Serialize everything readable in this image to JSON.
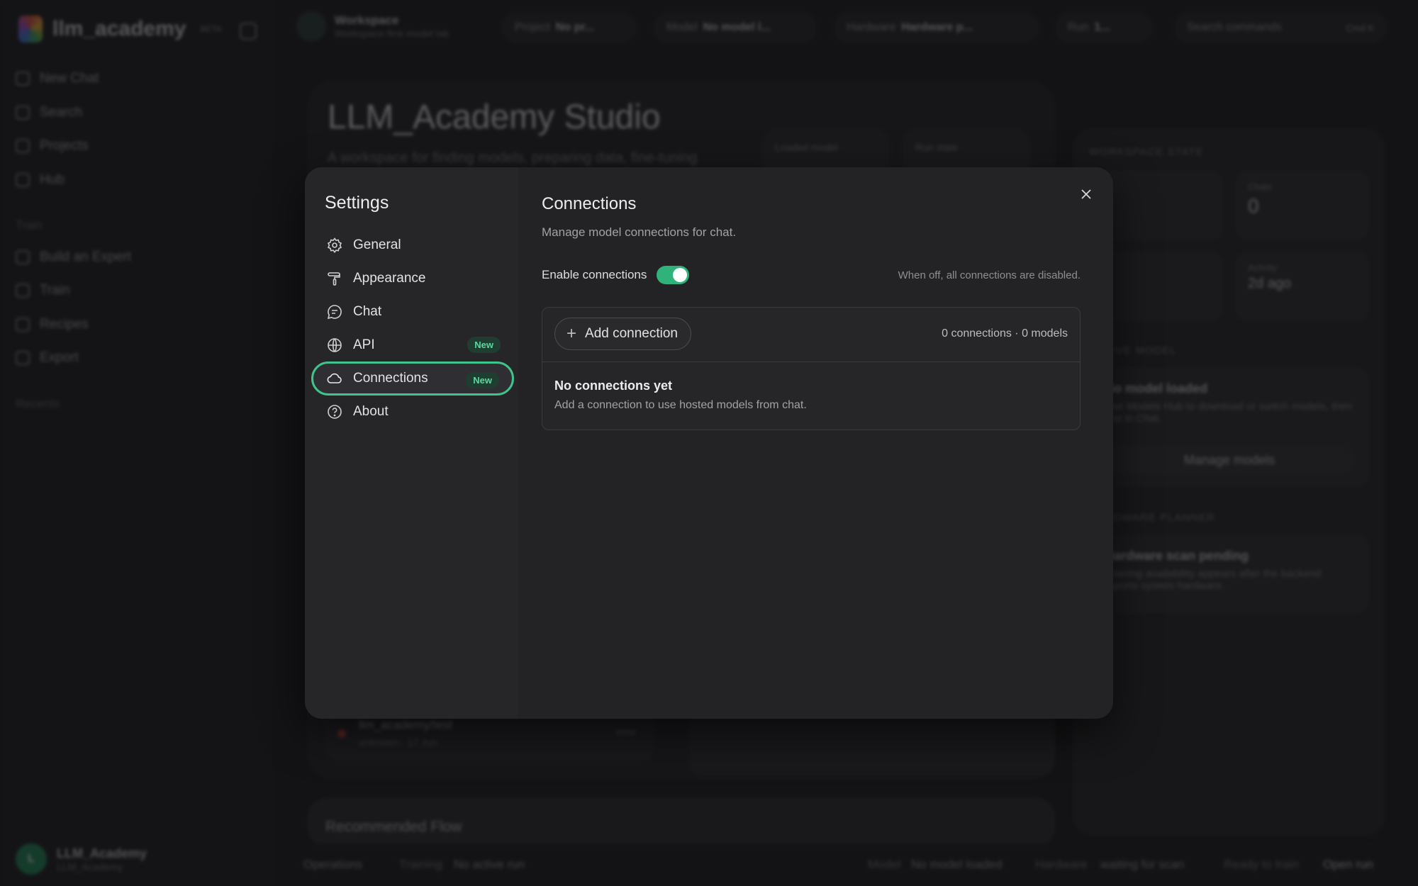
{
  "app": {
    "name": "llm_academy",
    "beta_label": "BETA",
    "sidebar": {
      "items": [
        {
          "label": "New Chat"
        },
        {
          "label": "Search"
        },
        {
          "label": "Projects"
        },
        {
          "label": "Hub"
        }
      ],
      "section_train": "Train",
      "train_items": [
        {
          "label": "Build an Expert"
        },
        {
          "label": "Train"
        },
        {
          "label": "Recipes"
        },
        {
          "label": "Export"
        }
      ],
      "section_recents": "Recents",
      "user": {
        "initial": "L",
        "name": "LLM_Academy",
        "sub": "LLM_Academy"
      }
    },
    "topbar": {
      "workspace_title": "Workspace",
      "workspace_sub": "Workspace-first model lab",
      "pills": [
        {
          "key": "Project",
          "value": "No pr..."
        },
        {
          "key": "Model",
          "value": "No model l..."
        },
        {
          "key": "Hardware",
          "value": "Hardware p..."
        },
        {
          "key": "Run",
          "value": "1..."
        }
      ],
      "search_placeholder": "Search commands",
      "search_shortcut": "Cmd K"
    },
    "hero": {
      "title": "LLM_Academy Studio",
      "subtitle": "A workspace for finding models, preparing data, fine-tuning",
      "stat1_label": "Loaded model",
      "stat2_label": "Run state"
    },
    "right_panel": {
      "workspace_state": "WORKSPACE STATE",
      "chats_label": "Chats",
      "chats_value": "0",
      "activity_label": "Activity",
      "activity_value": "2d ago",
      "active_model_section": "ACTIVE MODEL",
      "no_model": "No model loaded",
      "no_model_desc": "Use Models Hub to download or switch models, then test in Chat.",
      "manage_models": "Manage models",
      "hardware_section": "HARDWARE PLANNER",
      "hardware_title": "Hardware scan pending",
      "hardware_desc": "Training availability appears after the backend reports system hardware."
    },
    "recent_run": {
      "name": "llm_academy/test",
      "meta": "unknown · 17 Jun",
      "status": "error"
    },
    "recommended": "Recommended Flow",
    "bottombar": {
      "operations": "Operations",
      "training_label": "Training",
      "training_value": "No active run",
      "model_label": "Model",
      "model_value": "No model loaded",
      "hardware_label": "Hardware",
      "hardware_value": "waiting for scan",
      "ready": "Ready to train",
      "open_run": "Open run"
    }
  },
  "settings": {
    "title": "Settings",
    "nav": [
      {
        "label": "General",
        "icon": "gear-icon"
      },
      {
        "label": "Appearance",
        "icon": "paintbrush-icon"
      },
      {
        "label": "Chat",
        "icon": "chat-bubble-icon"
      },
      {
        "label": "API",
        "icon": "globe-icon",
        "badge": "New"
      },
      {
        "label": "Connections",
        "icon": "cloud-icon",
        "badge": "New",
        "active": true
      },
      {
        "label": "About",
        "icon": "help-circle-icon"
      }
    ],
    "connections": {
      "title": "Connections",
      "subtitle": "Manage model connections for chat.",
      "enable_label": "Enable connections",
      "enabled": true,
      "hint": "When off, all connections are disabled.",
      "add_button": "Add connection",
      "counts": "0 connections · 0 models",
      "empty_title": "No connections yet",
      "empty_sub": "Add a connection to use hosted models from chat."
    },
    "accent_color": "#3fc48c"
  }
}
